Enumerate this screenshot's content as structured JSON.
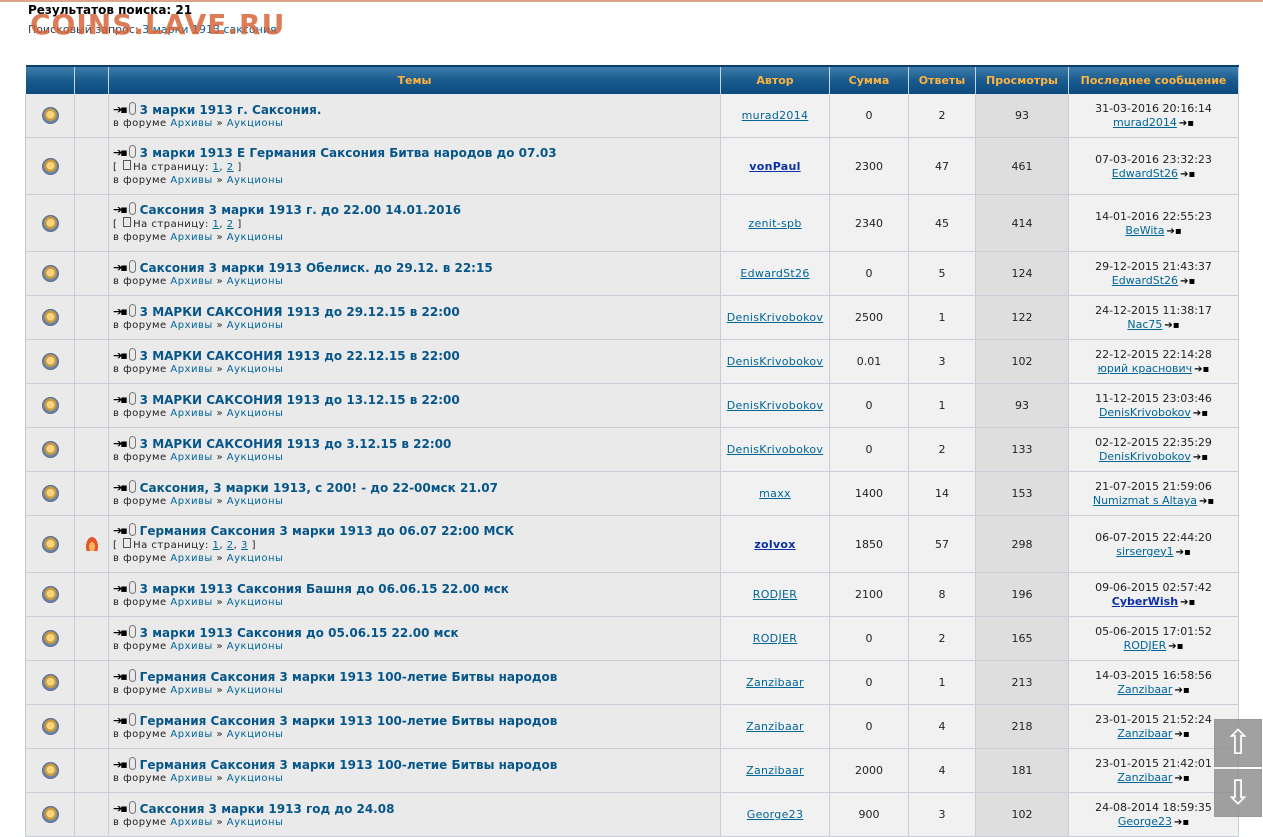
{
  "header": {
    "results_label": "Результатов поиска: 21",
    "query_prefix": "Поисковый запрос: ",
    "query_value": "3 марки 1913 саксония",
    "watermark": "COINS.LAVE.RU"
  },
  "columns": [
    "",
    "",
    "Темы",
    "Автор",
    "Сумма",
    "Ответы",
    "Просмотры",
    "Последнее сообщение"
  ],
  "pages_label": "На страницу:",
  "forum_prefix": "в форуме",
  "forum_path": [
    "Архивы",
    "Аукционы"
  ],
  "rows": [
    {
      "title": "3 марки 1913 г. Саксония.",
      "author": "murad2014",
      "author_bold": false,
      "sum": "0",
      "replies": "2",
      "views": "93",
      "last_date": "31-03-2016 20:16:14",
      "last_user": "murad2014",
      "last_user_bold": false,
      "pages": [],
      "hot": false
    },
    {
      "title": "3 марки 1913 E Германия Саксония Битва народов до 07.03",
      "author": "vonPaul",
      "author_bold": true,
      "sum": "2300",
      "replies": "47",
      "views": "461",
      "last_date": "07-03-2016 23:32:23",
      "last_user": "EdwardSt26",
      "last_user_bold": false,
      "pages": [
        "1",
        "2"
      ],
      "hot": false
    },
    {
      "title": "Саксония 3 марки 1913 г. до 22.00 14.01.2016",
      "author": "zenit-spb",
      "author_bold": false,
      "sum": "2340",
      "replies": "45",
      "views": "414",
      "last_date": "14-01-2016 22:55:23",
      "last_user": "BeWita",
      "last_user_bold": false,
      "pages": [
        "1",
        "2"
      ],
      "hot": false
    },
    {
      "title": "Саксония 3 марки 1913 Обелиск. до 29.12. в 22:15",
      "author": "EdwardSt26",
      "author_bold": false,
      "sum": "0",
      "replies": "5",
      "views": "124",
      "last_date": "29-12-2015 21:43:37",
      "last_user": "EdwardSt26",
      "last_user_bold": false,
      "pages": [],
      "hot": false
    },
    {
      "title": "3 МАРКИ САКСОНИЯ 1913 до 29.12.15 в 22:00",
      "author": "DenisKrivobokov",
      "author_bold": false,
      "sum": "2500",
      "replies": "1",
      "views": "122",
      "last_date": "24-12-2015 11:38:17",
      "last_user": "Nac75",
      "last_user_bold": false,
      "pages": [],
      "hot": false
    },
    {
      "title": "3 МАРКИ САКСОНИЯ 1913 до 22.12.15 в 22:00",
      "author": "DenisKrivobokov",
      "author_bold": false,
      "sum": "0.01",
      "replies": "3",
      "views": "102",
      "last_date": "22-12-2015 22:14:28",
      "last_user": "юрий краснович",
      "last_user_bold": false,
      "pages": [],
      "hot": false
    },
    {
      "title": "3 МАРКИ САКСОНИЯ 1913 до 13.12.15 в 22:00",
      "author": "DenisKrivobokov",
      "author_bold": false,
      "sum": "0",
      "replies": "1",
      "views": "93",
      "last_date": "11-12-2015 23:03:46",
      "last_user": "DenisKrivobokov",
      "last_user_bold": false,
      "pages": [],
      "hot": false
    },
    {
      "title": "3 МАРКИ САКСОНИЯ 1913 до 3.12.15 в 22:00",
      "author": "DenisKrivobokov",
      "author_bold": false,
      "sum": "0",
      "replies": "2",
      "views": "133",
      "last_date": "02-12-2015 22:35:29",
      "last_user": "DenisKrivobokov",
      "last_user_bold": false,
      "pages": [],
      "hot": false
    },
    {
      "title": "Саксония, 3 марки 1913, с 200! - до 22-00мск 21.07",
      "author": "maxx",
      "author_bold": false,
      "sum": "1400",
      "replies": "14",
      "views": "153",
      "last_date": "21-07-2015 21:59:06",
      "last_user": "Numizmat s Altaya",
      "last_user_bold": false,
      "pages": [],
      "hot": false
    },
    {
      "title": "Германия Саксония 3 марки 1913 до 06.07 22:00 МСК",
      "author": "zolvox",
      "author_bold": true,
      "sum": "1850",
      "replies": "57",
      "views": "298",
      "last_date": "06-07-2015 22:44:20",
      "last_user": "sirsergey1",
      "last_user_bold": false,
      "pages": [
        "1",
        "2",
        "3"
      ],
      "hot": true
    },
    {
      "title": "3 марки 1913 Саксония Башня до 06.06.15 22.00 мск",
      "author": "RODJER",
      "author_bold": false,
      "sum": "2100",
      "replies": "8",
      "views": "196",
      "last_date": "09-06-2015 02:57:42",
      "last_user": "CyberWish",
      "last_user_bold": true,
      "pages": [],
      "hot": false
    },
    {
      "title": "3 марки 1913 Саксония до 05.06.15 22.00 мск",
      "author": "RODJER",
      "author_bold": false,
      "sum": "0",
      "replies": "2",
      "views": "165",
      "last_date": "05-06-2015 17:01:52",
      "last_user": "RODJER",
      "last_user_bold": false,
      "pages": [],
      "hot": false
    },
    {
      "title": "Германия Саксония 3 марки 1913 100-летие Битвы народов",
      "author": "Zanzibaar",
      "author_bold": false,
      "sum": "0",
      "replies": "1",
      "views": "213",
      "last_date": "14-03-2015 16:58:56",
      "last_user": "Zanzibaar",
      "last_user_bold": false,
      "pages": [],
      "hot": false
    },
    {
      "title": "Германия Саксония 3 марки 1913 100-летие Битвы народов",
      "author": "Zanzibaar",
      "author_bold": false,
      "sum": "0",
      "replies": "4",
      "views": "218",
      "last_date": "23-01-2015 21:52:24",
      "last_user": "Zanzibaar",
      "last_user_bold": false,
      "pages": [],
      "hot": false
    },
    {
      "title": "Германия Саксония 3 марки 1913 100-летие Битвы народов",
      "author": "Zanzibaar",
      "author_bold": false,
      "sum": "2000",
      "replies": "4",
      "views": "181",
      "last_date": "23-01-2015 21:42:01",
      "last_user": "Zanzibaar",
      "last_user_bold": false,
      "pages": [],
      "hot": false
    },
    {
      "title": "Саксония 3 марки 1913 год до 24.08",
      "author": "George23",
      "author_bold": false,
      "sum": "900",
      "replies": "3",
      "views": "102",
      "last_date": "24-08-2014 18:59:35",
      "last_user": "George23",
      "last_user_bold": false,
      "pages": [],
      "hot": false
    }
  ],
  "scroll": {
    "up_symbol": "⇧",
    "down_symbol": "⇩"
  }
}
